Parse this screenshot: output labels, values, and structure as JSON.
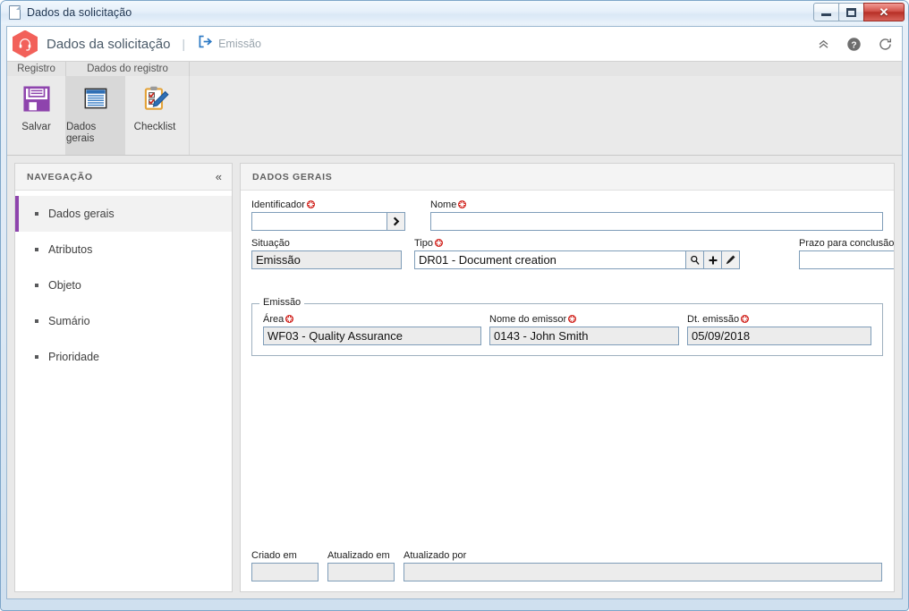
{
  "window": {
    "title": "Dados da solicitação",
    "icon": "document-icon",
    "controls": {
      "minimize": "minimize",
      "maximize": "maximize",
      "close": "✕"
    }
  },
  "header": {
    "logo_icon": "headset-hexagon-logo",
    "app_title": "Dados da solicitação",
    "separator": "|",
    "link_icon": "export-arrow-icon",
    "link_label": "Emissão",
    "actions": [
      {
        "name": "collapse-ribbon-icon",
        "glyph": "chevrons-up"
      },
      {
        "name": "help-icon",
        "glyph": "?"
      },
      {
        "name": "refresh-icon",
        "glyph": "refresh"
      }
    ]
  },
  "ribbon": {
    "tabs": [
      {
        "label": "Registro"
      },
      {
        "label": "Dados do registro"
      }
    ],
    "items": [
      {
        "label": "Salvar",
        "icon": "floppy-save-icon",
        "active": false
      },
      {
        "label": "Dados gerais",
        "icon": "general-data-icon",
        "active": true
      },
      {
        "label": "Checklist",
        "icon": "checklist-clipboard-icon",
        "active": false
      }
    ]
  },
  "sidebar": {
    "title": "NAVEGAÇÃO",
    "collapse_glyph": "«",
    "items": [
      {
        "label": "Dados gerais",
        "active": true
      },
      {
        "label": "Atributos",
        "active": false
      },
      {
        "label": "Objeto",
        "active": false
      },
      {
        "label": "Sumário",
        "active": false
      },
      {
        "label": "Prioridade",
        "active": false
      }
    ]
  },
  "main": {
    "title": "DADOS GERAIS",
    "fields": {
      "identificador": {
        "label": "Identificador",
        "required": true,
        "value": "",
        "placeholder": "",
        "button_icon": "chevron-right-icon"
      },
      "nome": {
        "label": "Nome",
        "required": true,
        "value": "",
        "placeholder": ""
      },
      "situacao": {
        "label": "Situação",
        "required": false,
        "value": "Emissão",
        "readonly": true
      },
      "tipo": {
        "label": "Tipo",
        "required": true,
        "value": "DR01 - Document creation",
        "buttons": [
          {
            "name": "search-icon",
            "glyph": "magnifier"
          },
          {
            "name": "add-icon",
            "glyph": "plus"
          },
          {
            "name": "clear-icon",
            "glyph": "brush"
          }
        ]
      },
      "prazo": {
        "label": "Prazo para conclusão",
        "required": false,
        "value": "",
        "buttons": [
          {
            "name": "calendar-icon",
            "glyph": "calendar"
          },
          {
            "name": "clear-icon",
            "glyph": "brush"
          }
        ]
      }
    },
    "emissao_group": {
      "legend": "Emissão",
      "fields": {
        "area": {
          "label": "Área",
          "required": true,
          "value": "WF03 - Quality Assurance",
          "readonly": true
        },
        "emissor": {
          "label": "Nome do emissor",
          "required": true,
          "value": "0143 - John Smith",
          "readonly": true
        },
        "dt_emissao": {
          "label": "Dt. emissão",
          "required": true,
          "value": "05/09/2018",
          "readonly": true
        }
      }
    },
    "audit_fields": {
      "criado_em": {
        "label": "Criado em",
        "value": "",
        "readonly": true
      },
      "atualizado_em": {
        "label": "Atualizado em",
        "value": "",
        "readonly": true
      },
      "atualizado_por": {
        "label": "Atualizado por",
        "value": "",
        "readonly": true
      }
    }
  },
  "colors": {
    "accent_purple": "#8e44ad",
    "logo_red": "#f2615a",
    "required_red": "#d0201a",
    "link_blue": "#2b78c4",
    "field_border": "#7f9db9"
  }
}
